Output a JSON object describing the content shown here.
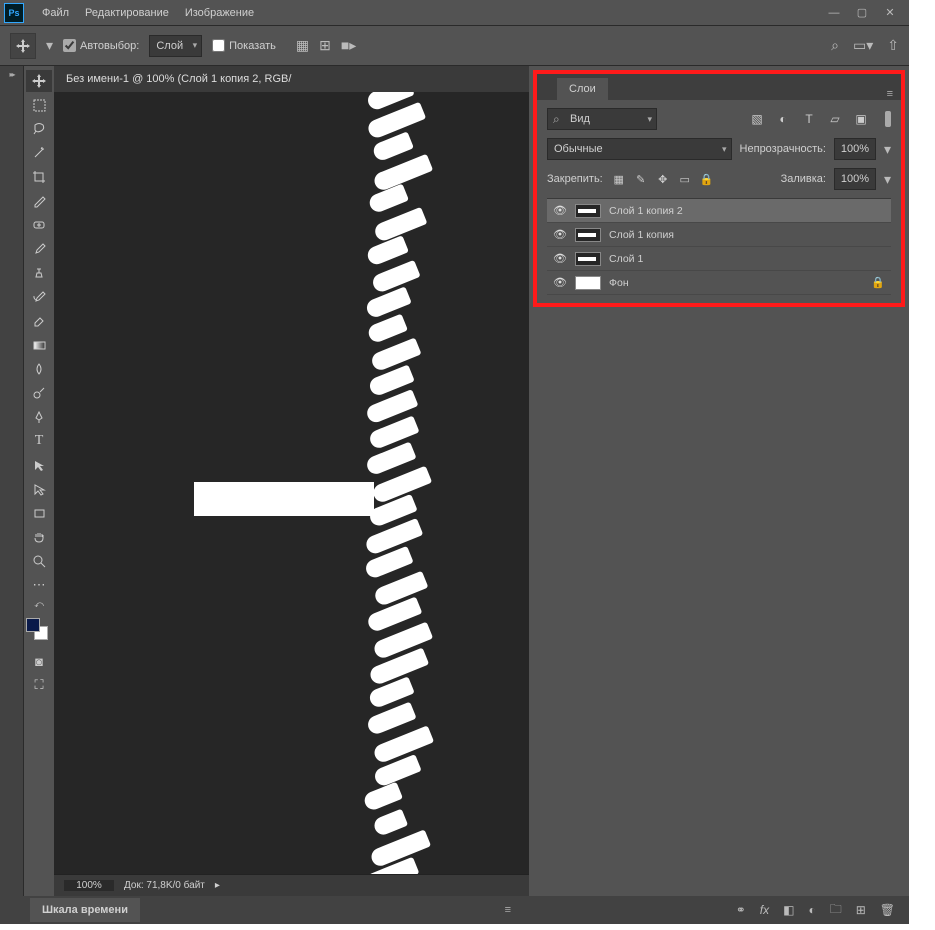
{
  "app_logo": "Ps",
  "menu": {
    "file": "Файл",
    "edit": "Редактирование",
    "image": "Изображение"
  },
  "options": {
    "autoselect_label": "Автовыбор:",
    "layer_dropdown": "Слой",
    "show_label": "Показать"
  },
  "document": {
    "tab_title": "Без имени-1 @ 100% (Слой 1 копия 2, RGB/",
    "zoom": "100%",
    "doc_info": "Док: 71,8K/0 байт"
  },
  "layers_panel": {
    "tab": "Слои",
    "search_placeholder": "Вид",
    "blend_mode": "Обычные",
    "opacity_label": "Непрозрачность:",
    "opacity_value": "100%",
    "lock_label": "Закрепить:",
    "fill_label": "Заливка:",
    "fill_value": "100%",
    "layers": [
      {
        "name": "Слой 1 копия 2",
        "selected": true,
        "locked": false
      },
      {
        "name": "Слой 1 копия",
        "selected": false,
        "locked": false
      },
      {
        "name": "Слой 1",
        "selected": false,
        "locked": false
      },
      {
        "name": "Фон",
        "selected": false,
        "locked": true
      }
    ]
  },
  "timeline": {
    "tab": "Шкала времени"
  }
}
